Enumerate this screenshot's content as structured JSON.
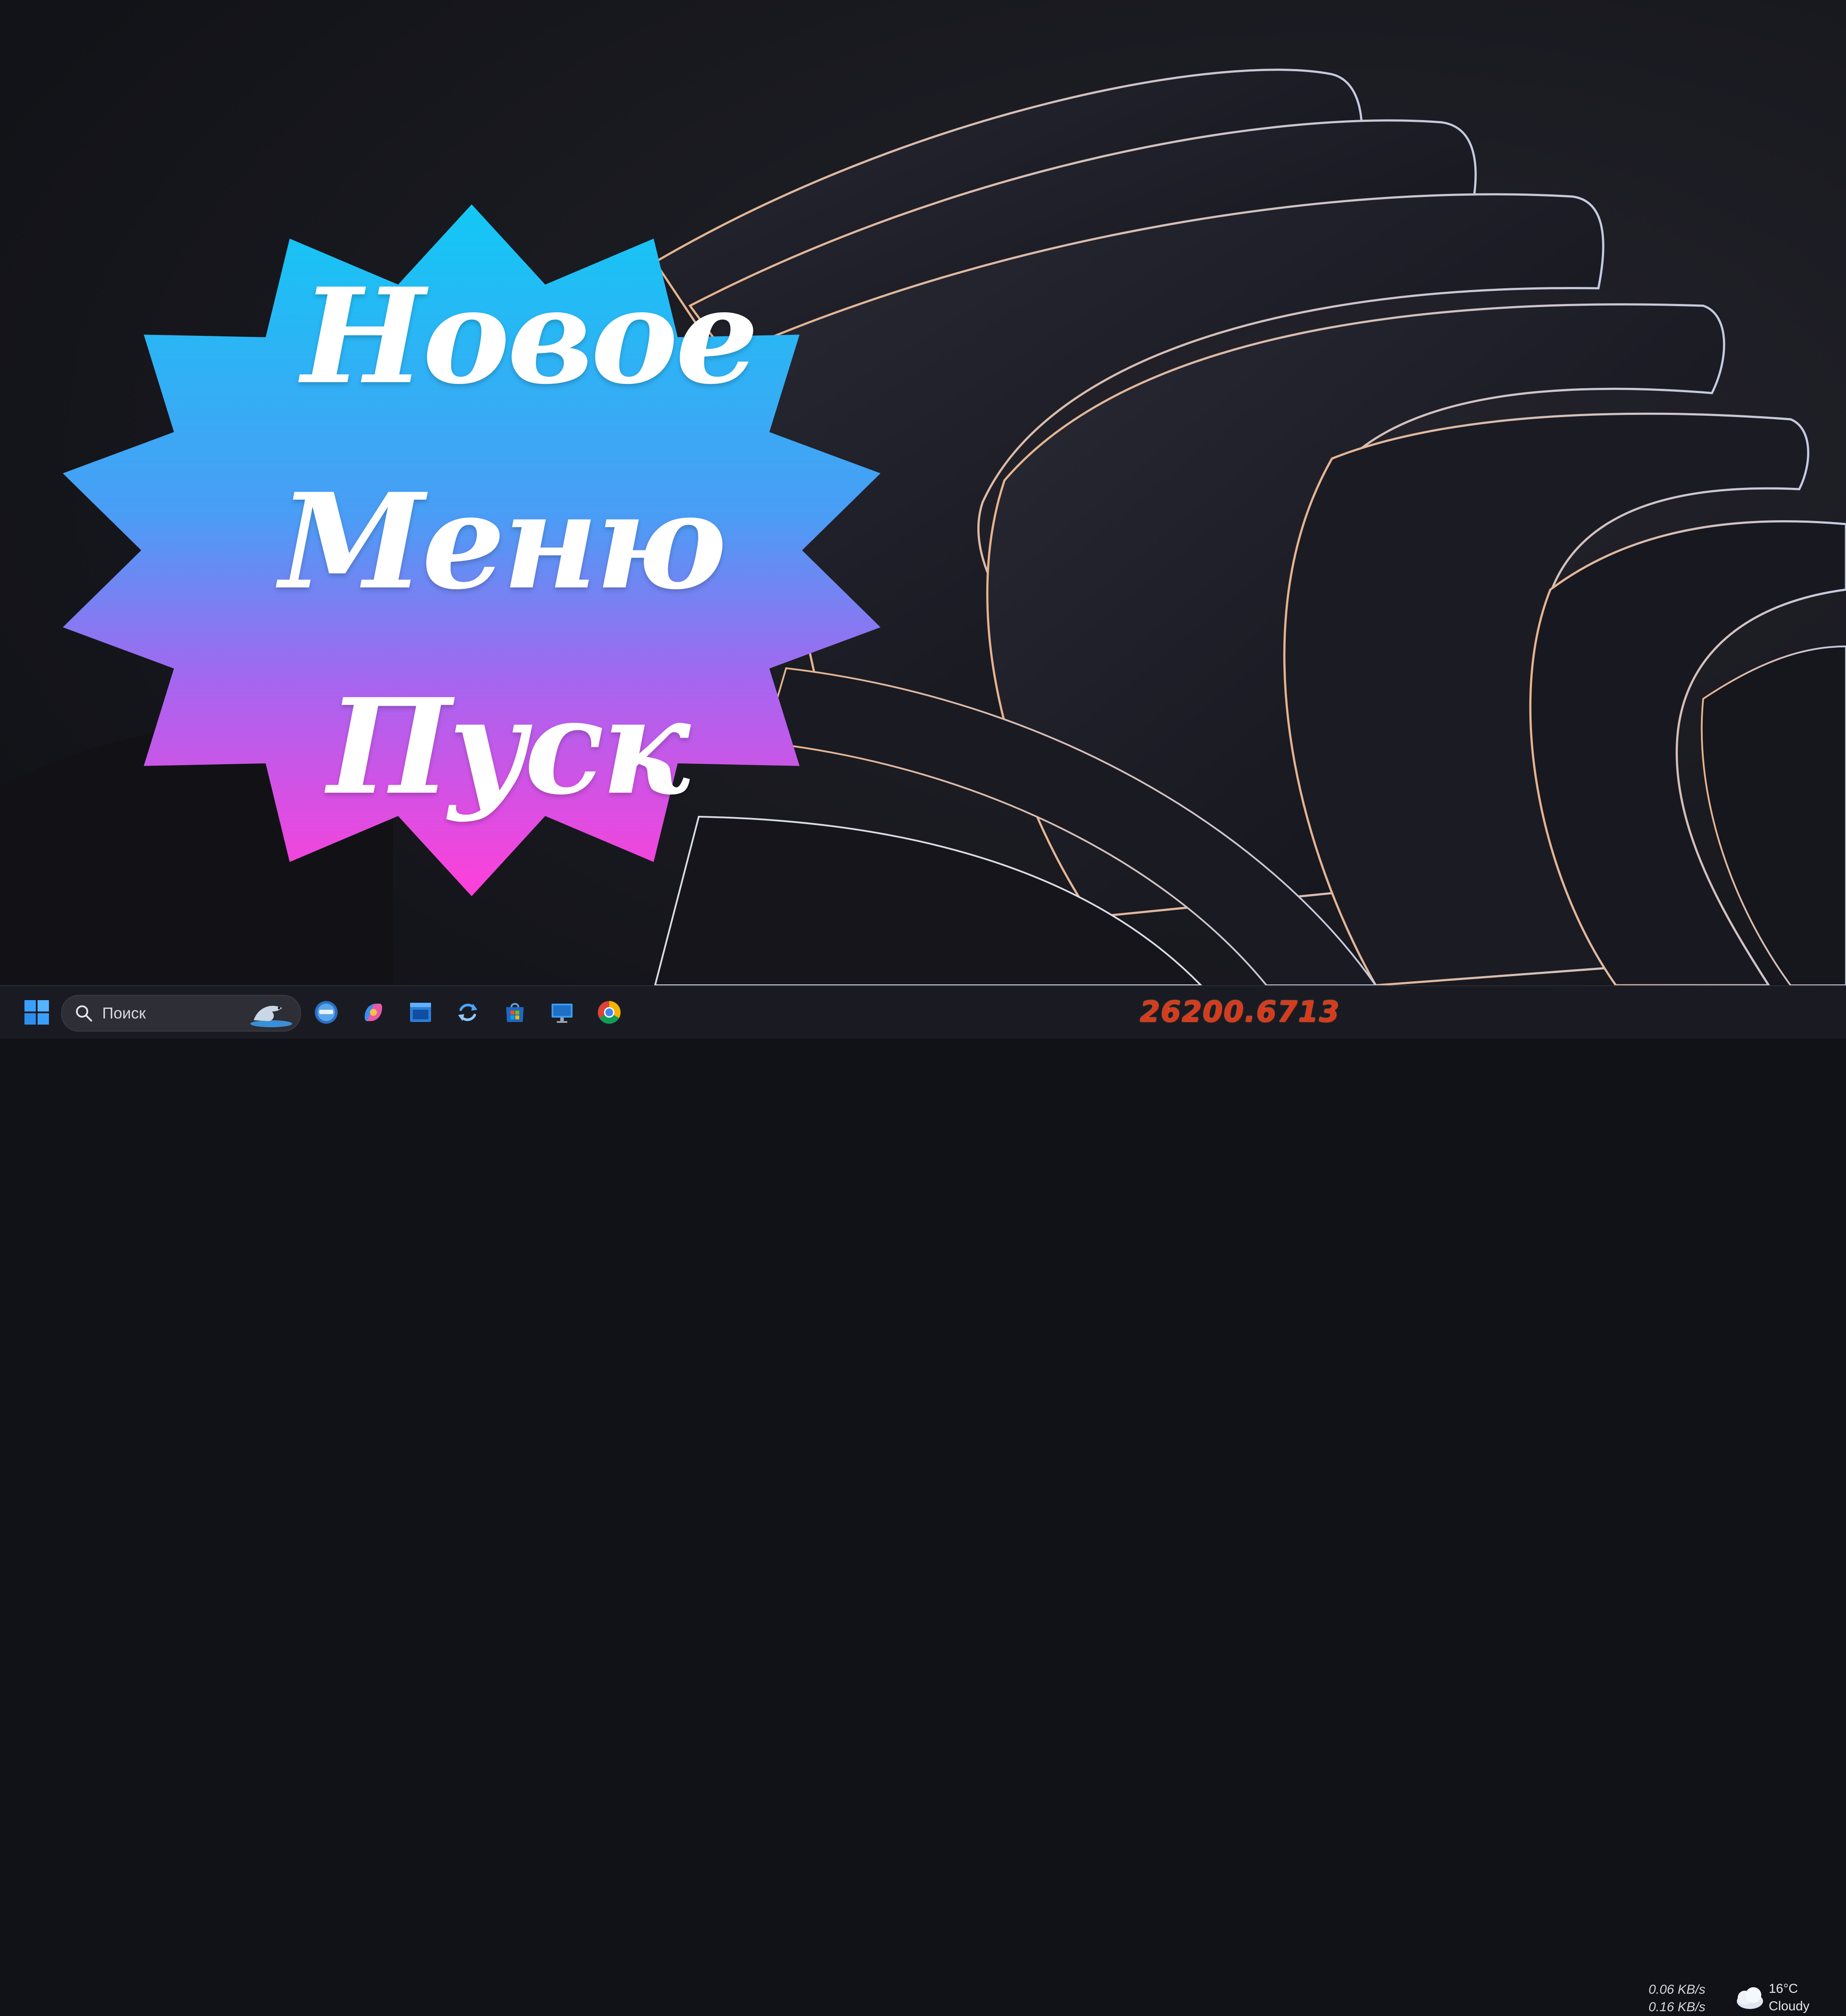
{
  "headline": {
    "line1": "Новое",
    "line2": "Меню",
    "line3": "Пуск"
  },
  "taskbar": {
    "search_placeholder": "Поиск",
    "pinned_icons": [
      "start-icon",
      "edge-icon",
      "copilot-icon",
      "window-icon",
      "refresh-icon",
      "store-icon",
      "monitor-icon",
      "chrome-icon"
    ]
  },
  "build_number": "26200.6713",
  "network": {
    "upload": "0.06 KB/s",
    "download": "0.16 KB/s"
  },
  "weather": {
    "temperature": "16°C",
    "condition": "Cloudy"
  },
  "colors": {
    "badge_top": "#12c8f5",
    "badge_mid": "#7b7cf0",
    "badge_bottom": "#ff3fd9",
    "build_text": "#d83a1c",
    "taskbar_bg": "#1a1b22"
  }
}
